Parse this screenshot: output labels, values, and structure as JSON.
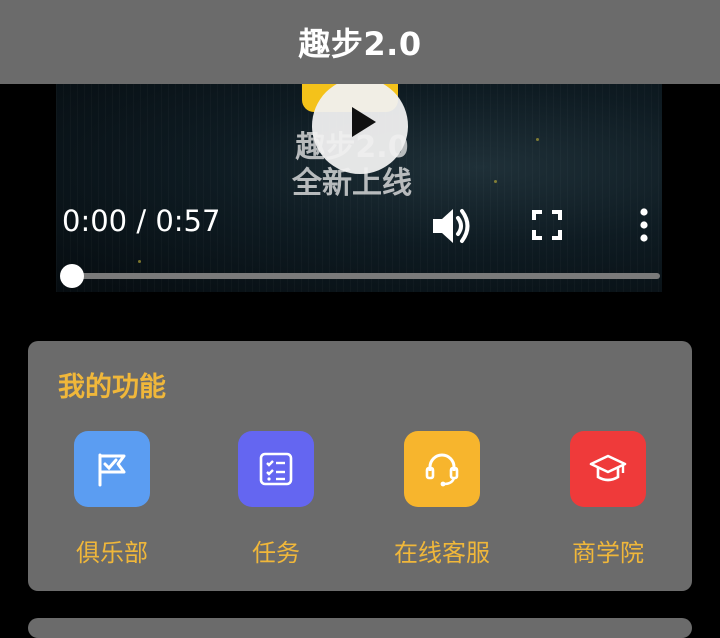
{
  "header": {
    "title": "趣步2.0"
  },
  "video": {
    "overlay_line1": "趣步2.0",
    "overlay_line2": "全新上线",
    "time_display": "0:00 / 0:57",
    "progress": 0.0,
    "icons": [
      "play-icon",
      "volume-icon",
      "fullscreen-icon",
      "more-vert-icon"
    ]
  },
  "features": {
    "title": "我的功能",
    "items": [
      {
        "label": "俱乐部",
        "icon": "flag-icon",
        "color": "#5b9df2"
      },
      {
        "label": "任务",
        "icon": "task-list-icon",
        "color": "#6466f1"
      },
      {
        "label": "在线客服",
        "icon": "headset-icon",
        "color": "#f7b52d"
      },
      {
        "label": "商学院",
        "icon": "graduation-cap-icon",
        "color": "#ef3a3a"
      }
    ]
  },
  "colors": {
    "header_bg": "#6b6b6b",
    "card_bg": "#6b6b6b",
    "accent_text": "#f0b73a"
  }
}
